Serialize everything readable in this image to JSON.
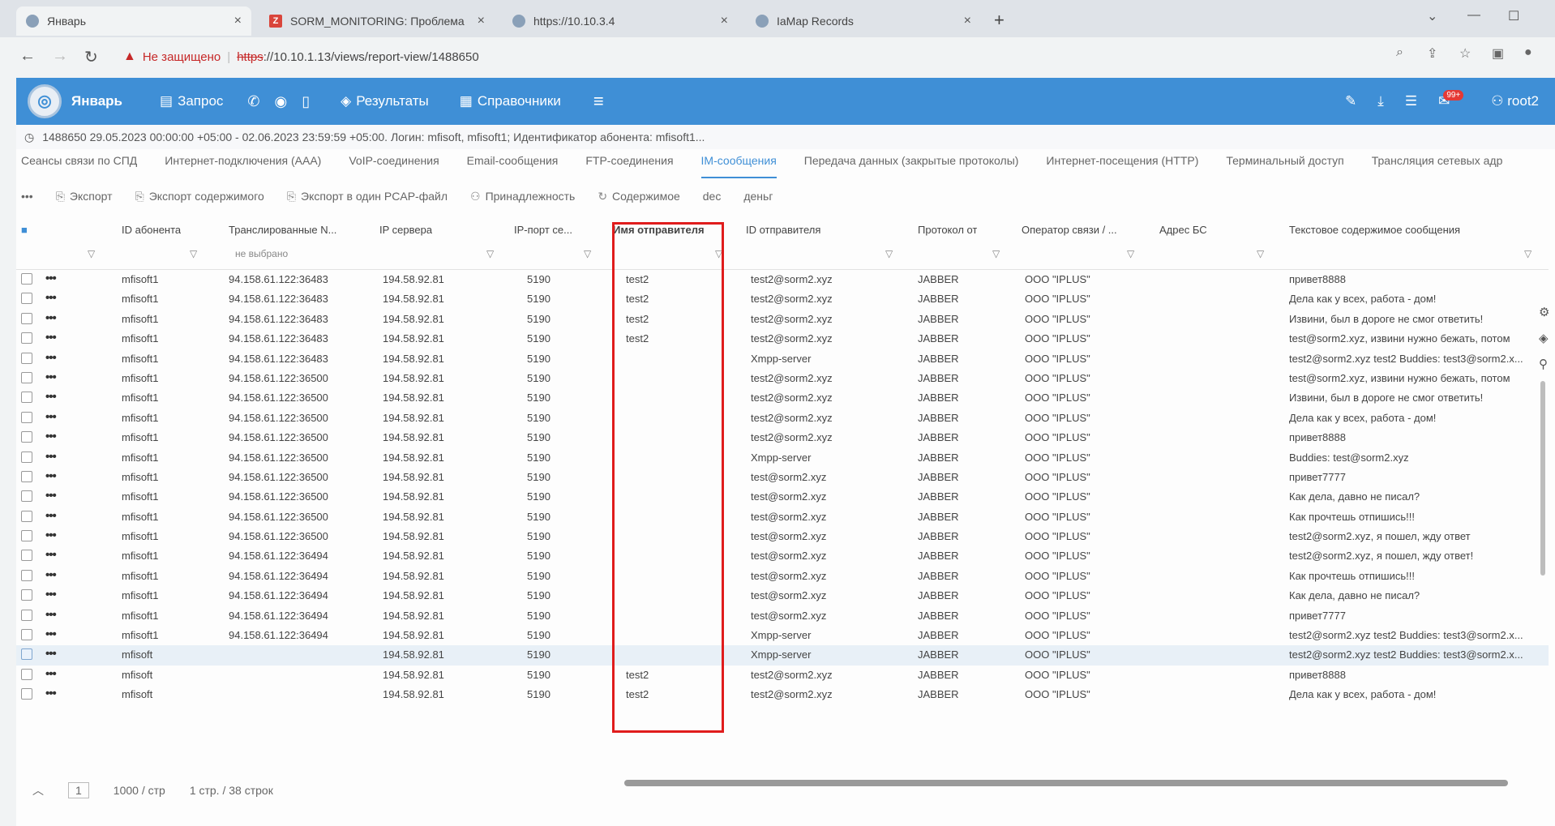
{
  "browser": {
    "tabs": [
      {
        "title": "Январь",
        "active": true
      },
      {
        "title": "SORM_MONITORING: Проблема",
        "active": false
      },
      {
        "title": "https://10.10.3.4",
        "active": false
      },
      {
        "title": "IaMap Records",
        "active": false
      }
    ],
    "address": {
      "security_label": "Не защищено",
      "scheme": "https",
      "url_rest": "://10.10.1.13/views/report-view/1488650"
    }
  },
  "app": {
    "name": "Январь",
    "nav": {
      "request_label": "Запрос",
      "results_label": "Результаты",
      "directories_label": "Справочники"
    },
    "user": "root2",
    "notif_badge": "99+"
  },
  "infoline": "1488650   29.05.2023 00:00:00 +05:00 - 02.06.2023 23:59:59 +05:00. Логин: mfisoft, mfisoft1; Идентификатор абонента: mfisoft1...",
  "tabs": [
    "Сеансы связи по СПД",
    "Интернет-подключения (AAA)",
    "VoIP-соединения",
    "Email-сообщения",
    "FTP-соединения",
    "IM-сообщения",
    "Передача данных (закрытые протоколы)",
    "Интернет-посещения (HTTP)",
    "Терминальный доступ",
    "Трансляция сетевых адр"
  ],
  "active_tab_index": 5,
  "toolbar": {
    "more": "•••",
    "export": "Экспорт",
    "export_content": "Экспорт содержимого",
    "export_pcap": "Экспорт в один PCAP-файл",
    "ownership": "Принадлежность",
    "content": "Содержимое",
    "dec": "dec",
    "hex": "деньг"
  },
  "columns": {
    "subscriber_id": "ID абонента",
    "translated": "Транслированные N...",
    "translated_sub": "не выбрано",
    "server_ip": "IP сервера",
    "server_port": "IP-порт се...",
    "sender_name": "Имя отправителя",
    "sender_id": "ID отправителя",
    "protocol": "Протокол от",
    "operator": "Оператор связи / ...",
    "bs_address": "Адрес БС",
    "message_text": "Текстовое содержимое сообщения"
  },
  "rows": [
    {
      "sub": "mfisoft1",
      "trans": "94.158.61.122:36483",
      "ip": "194.58.92.81",
      "port": "5190",
      "name": "test2",
      "sid": "test2@sorm2.xyz",
      "proto": "JABBER",
      "op": "ООО \"IPLUS\"",
      "msg": "привет8888"
    },
    {
      "sub": "mfisoft1",
      "trans": "94.158.61.122:36483",
      "ip": "194.58.92.81",
      "port": "5190",
      "name": "test2",
      "sid": "test2@sorm2.xyz",
      "proto": "JABBER",
      "op": "ООО \"IPLUS\"",
      "msg": "Дела как у всех, работа - дом!"
    },
    {
      "sub": "mfisoft1",
      "trans": "94.158.61.122:36483",
      "ip": "194.58.92.81",
      "port": "5190",
      "name": "test2",
      "sid": "test2@sorm2.xyz",
      "proto": "JABBER",
      "op": "ООО \"IPLUS\"",
      "msg": "Извини, был в дороге не смог ответить!"
    },
    {
      "sub": "mfisoft1",
      "trans": "94.158.61.122:36483",
      "ip": "194.58.92.81",
      "port": "5190",
      "name": "test2",
      "sid": "test2@sorm2.xyz",
      "proto": "JABBER",
      "op": "ООО \"IPLUS\"",
      "msg": "test@sorm2.xyz, извини нужно бежать, потом"
    },
    {
      "sub": "mfisoft1",
      "trans": "94.158.61.122:36483",
      "ip": "194.58.92.81",
      "port": "5190",
      "name": "",
      "sid": "Xmpp-server",
      "proto": "JABBER",
      "op": "ООО \"IPLUS\"",
      "msg": "test2@sorm2.xyz test2 Buddies: test3@sorm2.x..."
    },
    {
      "sub": "mfisoft1",
      "trans": "94.158.61.122:36500",
      "ip": "194.58.92.81",
      "port": "5190",
      "name": "",
      "sid": "test2@sorm2.xyz",
      "proto": "JABBER",
      "op": "ООО \"IPLUS\"",
      "msg": "test@sorm2.xyz, извини нужно бежать, потом"
    },
    {
      "sub": "mfisoft1",
      "trans": "94.158.61.122:36500",
      "ip": "194.58.92.81",
      "port": "5190",
      "name": "",
      "sid": "test2@sorm2.xyz",
      "proto": "JABBER",
      "op": "ООО \"IPLUS\"",
      "msg": "Извини, был в дороге не смог ответить!"
    },
    {
      "sub": "mfisoft1",
      "trans": "94.158.61.122:36500",
      "ip": "194.58.92.81",
      "port": "5190",
      "name": "",
      "sid": "test2@sorm2.xyz",
      "proto": "JABBER",
      "op": "ООО \"IPLUS\"",
      "msg": "Дела как у всех, работа - дом!"
    },
    {
      "sub": "mfisoft1",
      "trans": "94.158.61.122:36500",
      "ip": "194.58.92.81",
      "port": "5190",
      "name": "",
      "sid": "test2@sorm2.xyz",
      "proto": "JABBER",
      "op": "ООО \"IPLUS\"",
      "msg": "привет8888"
    },
    {
      "sub": "mfisoft1",
      "trans": "94.158.61.122:36500",
      "ip": "194.58.92.81",
      "port": "5190",
      "name": "",
      "sid": "Xmpp-server",
      "proto": "JABBER",
      "op": "ООО \"IPLUS\"",
      "msg": "Buddies: test@sorm2.xyz"
    },
    {
      "sub": "mfisoft1",
      "trans": "94.158.61.122:36500",
      "ip": "194.58.92.81",
      "port": "5190",
      "name": "",
      "sid": "test@sorm2.xyz",
      "proto": "JABBER",
      "op": "ООО \"IPLUS\"",
      "msg": "привет7777"
    },
    {
      "sub": "mfisoft1",
      "trans": "94.158.61.122:36500",
      "ip": "194.58.92.81",
      "port": "5190",
      "name": "",
      "sid": "test@sorm2.xyz",
      "proto": "JABBER",
      "op": "ООО \"IPLUS\"",
      "msg": "Как дела, давно не писал?"
    },
    {
      "sub": "mfisoft1",
      "trans": "94.158.61.122:36500",
      "ip": "194.58.92.81",
      "port": "5190",
      "name": "",
      "sid": "test@sorm2.xyz",
      "proto": "JABBER",
      "op": "ООО \"IPLUS\"",
      "msg": "Как прочтешь отпишись!!!"
    },
    {
      "sub": "mfisoft1",
      "trans": "94.158.61.122:36500",
      "ip": "194.58.92.81",
      "port": "5190",
      "name": "",
      "sid": "test@sorm2.xyz",
      "proto": "JABBER",
      "op": "ООО \"IPLUS\"",
      "msg": "test2@sorm2.xyz, я пошел, жду ответ"
    },
    {
      "sub": "mfisoft1",
      "trans": "94.158.61.122:36494",
      "ip": "194.58.92.81",
      "port": "5190",
      "name": "",
      "sid": "test@sorm2.xyz",
      "proto": "JABBER",
      "op": "ООО \"IPLUS\"",
      "msg": "test2@sorm2.xyz, я пошел, жду ответ!"
    },
    {
      "sub": "mfisoft1",
      "trans": "94.158.61.122:36494",
      "ip": "194.58.92.81",
      "port": "5190",
      "name": "",
      "sid": "test@sorm2.xyz",
      "proto": "JABBER",
      "op": "ООО \"IPLUS\"",
      "msg": "Как прочтешь отпишись!!!"
    },
    {
      "sub": "mfisoft1",
      "trans": "94.158.61.122:36494",
      "ip": "194.58.92.81",
      "port": "5190",
      "name": "",
      "sid": "test@sorm2.xyz",
      "proto": "JABBER",
      "op": "ООО \"IPLUS\"",
      "msg": "Как дела, давно не писал?"
    },
    {
      "sub": "mfisoft1",
      "trans": "94.158.61.122:36494",
      "ip": "194.58.92.81",
      "port": "5190",
      "name": "",
      "sid": "test@sorm2.xyz",
      "proto": "JABBER",
      "op": "ООО \"IPLUS\"",
      "msg": "привет7777"
    },
    {
      "sub": "mfisoft1",
      "trans": "94.158.61.122:36494",
      "ip": "194.58.92.81",
      "port": "5190",
      "name": "",
      "sid": "Xmpp-server",
      "proto": "JABBER",
      "op": "ООО \"IPLUS\"",
      "msg": "test2@sorm2.xyz test2 Buddies: test3@sorm2.x..."
    },
    {
      "sub": "mfisoft",
      "trans": "",
      "ip": "194.58.92.81",
      "port": "5190",
      "name": "",
      "sid": "Xmpp-server",
      "proto": "JABBER",
      "op": "ООО \"IPLUS\"",
      "msg": "test2@sorm2.xyz test2 Buddies: test3@sorm2.x...",
      "selected": true
    },
    {
      "sub": "mfisoft",
      "trans": "",
      "ip": "194.58.92.81",
      "port": "5190",
      "name": "test2",
      "sid": "test2@sorm2.xyz",
      "proto": "JABBER",
      "op": "ООО \"IPLUS\"",
      "msg": "привет8888"
    },
    {
      "sub": "mfisoft",
      "trans": "",
      "ip": "194.58.92.81",
      "port": "5190",
      "name": "test2",
      "sid": "test2@sorm2.xyz",
      "proto": "JABBER",
      "op": "ООО \"IPLUS\"",
      "msg": "Дела как у всех, работа - дом!"
    }
  ],
  "pager": {
    "page": "1",
    "per_page": "1000 / стр",
    "summary": "1 стр. / 38 строк"
  }
}
